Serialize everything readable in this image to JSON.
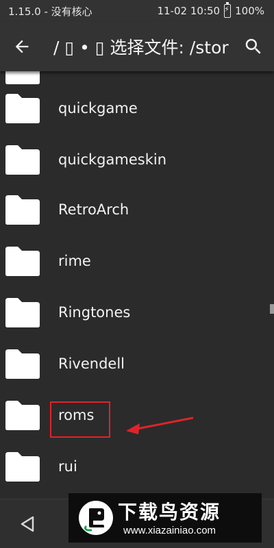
{
  "status_bar": {
    "left_text": "1.15.0 - 没有核心",
    "datetime": "11-02 10:50",
    "battery": "100%"
  },
  "app_bar": {
    "title": "/ ▯ • ▯ 选择文件: /stor",
    "back_icon": "arrow-left-icon",
    "search_icon": "search-icon"
  },
  "folders": [
    {
      "name": "quickgame"
    },
    {
      "name": "quickgameskin"
    },
    {
      "name": "RetroArch"
    },
    {
      "name": "rime"
    },
    {
      "name": "Ringtones"
    },
    {
      "name": "Rivendell"
    },
    {
      "name": "roms"
    },
    {
      "name": "rui"
    }
  ],
  "highlighted_folder": "roms",
  "colors": {
    "background": "#2b2b2b",
    "bar": "#333333",
    "text": "#f2f2f2",
    "annotation": "#e0232b",
    "folder": "#ffffff"
  },
  "watermark": {
    "title": "下载鸟资源",
    "url": "www.xiazainiao.com"
  }
}
